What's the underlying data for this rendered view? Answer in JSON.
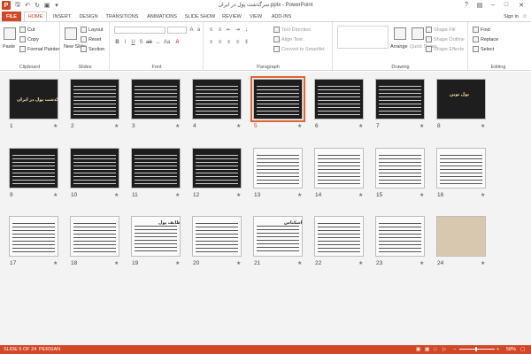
{
  "window": {
    "title": "سرگذشت پول در ایران.pptx - PowerPoint",
    "help": "?"
  },
  "tabs": [
    {
      "label": "FILE"
    },
    {
      "label": "HOME"
    },
    {
      "label": "INSERT"
    },
    {
      "label": "DESIGN"
    },
    {
      "label": "TRANSITIONS"
    },
    {
      "label": "ANIMATIONS"
    },
    {
      "label": "SLIDE SHOW"
    },
    {
      "label": "REVIEW"
    },
    {
      "label": "VIEW"
    },
    {
      "label": "ADD-INS"
    }
  ],
  "account": {
    "signin": "Sign in"
  },
  "ribbon": {
    "clipboard": {
      "label": "Clipboard",
      "paste": "Paste",
      "cut": "Cut",
      "copy": "Copy",
      "format_painter": "Format Painter"
    },
    "slides": {
      "label": "Slides",
      "new_slide": "New Slide",
      "layout": "Layout",
      "reset": "Reset",
      "section": "Section"
    },
    "font": {
      "label": "Font"
    },
    "paragraph": {
      "label": "Paragraph",
      "text_direction": "Text Direction",
      "align_text": "Align Text",
      "convert_smartart": "Convert to SmartArt"
    },
    "drawing": {
      "label": "Drawing",
      "arrange": "Arrange",
      "quick_styles": "Quick Styles",
      "shape_fill": "Shape Fill",
      "shape_outline": "Shape Outline",
      "shape_effects": "Shape Effects"
    },
    "editing": {
      "label": "Editing",
      "find": "Find",
      "replace": "Replace",
      "select": "Select"
    }
  },
  "slides": [
    {
      "n": "1",
      "star": "★",
      "title": "سرگذشت پول در ایران"
    },
    {
      "n": "2",
      "star": "★"
    },
    {
      "n": "3",
      "star": "★"
    },
    {
      "n": "4",
      "star": "★"
    },
    {
      "n": "5",
      "star": "★"
    },
    {
      "n": "6",
      "star": "★"
    },
    {
      "n": "7",
      "star": "★"
    },
    {
      "n": "8",
      "star": "★",
      "title": "پول نوین"
    },
    {
      "n": "9",
      "star": "★"
    },
    {
      "n": "10",
      "star": "★"
    },
    {
      "n": "11",
      "star": "★"
    },
    {
      "n": "12",
      "star": "★"
    },
    {
      "n": "13",
      "star": "★"
    },
    {
      "n": "14",
      "star": "★"
    },
    {
      "n": "15",
      "star": "★"
    },
    {
      "n": "16",
      "star": "★"
    },
    {
      "n": "17",
      "star": "★"
    },
    {
      "n": "18",
      "star": "★"
    },
    {
      "n": "19",
      "star": "★",
      "title": "وظایف پول"
    },
    {
      "n": "20",
      "star": "★"
    },
    {
      "n": "21",
      "star": "★",
      "title": "اسکناس"
    },
    {
      "n": "22",
      "star": "★"
    },
    {
      "n": "23",
      "star": "★"
    },
    {
      "n": "24",
      "star": "★"
    }
  ],
  "status": {
    "slide": "SLIDE 5 OF 24",
    "language": "PERSIAN",
    "zoom": "58%"
  },
  "colors": {
    "accent": "#d24726",
    "selection": "#e0652f"
  }
}
